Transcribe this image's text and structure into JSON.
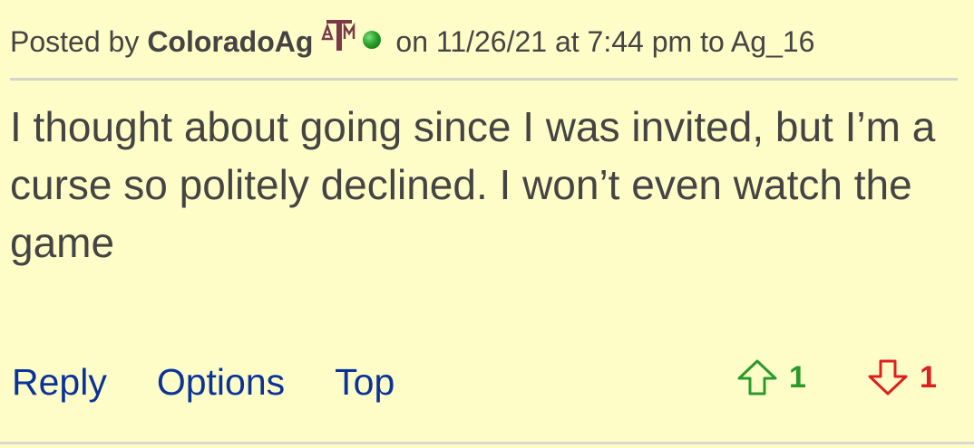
{
  "post": {
    "header": {
      "posted_by_label": "Posted by",
      "username": "ColoradoAg",
      "team_logo_text": "ATM",
      "meta": "on 11/26/21 at 7:44 pm to Ag_16"
    },
    "body": "I thought about going since I was invited, but I’m a curse so politely declined. I won’t even watch the game",
    "actions": {
      "reply": "Reply",
      "options": "Options",
      "top": "Top"
    },
    "votes": {
      "up_count": "1",
      "down_count": "1"
    }
  },
  "colors": {
    "background": "#fefdc8",
    "text": "#444444",
    "link": "#0a3399",
    "upvote": "#2a9a2a",
    "downvote": "#dd1f1f",
    "online": "#2aa12a",
    "logo": "#7a3a4a"
  },
  "icons": {
    "team_logo": "texas-am-logo-icon",
    "online_status": "online-status-icon",
    "upvote": "arrow-up-icon",
    "downvote": "arrow-down-icon"
  }
}
